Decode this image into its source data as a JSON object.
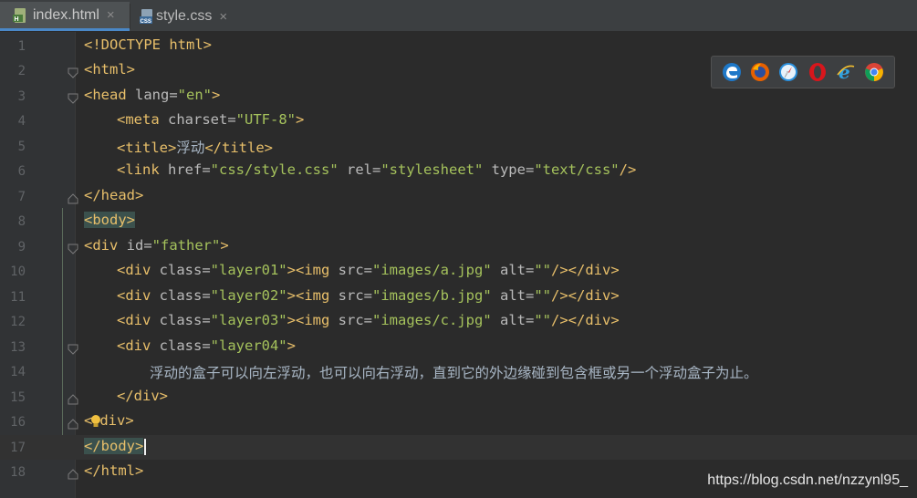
{
  "tabs": [
    {
      "label": "index.html",
      "icon": "html-file-icon",
      "active": true
    },
    {
      "label": "style.css",
      "icon": "css-file-icon",
      "active": false
    }
  ],
  "tab_close_glyph": "×",
  "browsers": [
    "edge-icon",
    "firefox-icon",
    "safari-icon",
    "opera-icon",
    "ie-icon",
    "chrome-icon"
  ],
  "lines": [
    {
      "n": "1"
    },
    {
      "n": "2"
    },
    {
      "n": "3"
    },
    {
      "n": "4"
    },
    {
      "n": "5"
    },
    {
      "n": "6"
    },
    {
      "n": "7"
    },
    {
      "n": "8"
    },
    {
      "n": "9"
    },
    {
      "n": "10"
    },
    {
      "n": "11"
    },
    {
      "n": "12"
    },
    {
      "n": "13"
    },
    {
      "n": "14"
    },
    {
      "n": "15"
    },
    {
      "n": "16"
    },
    {
      "n": "17"
    },
    {
      "n": "18"
    }
  ],
  "code": {
    "l1": "<!DOCTYPE html>",
    "l2": "<html>",
    "l3_tag": "<head",
    "l3_attr": " lang=",
    "l3_val": "\"en\"",
    "l3_end": ">",
    "l4_tag": "<meta",
    "l4_attr": " charset=",
    "l4_val": "\"UTF-8\"",
    "l4_end": ">",
    "l5_open": "<title>",
    "l5_text": "浮动",
    "l5_close": "</title>",
    "l6_tag": "<link",
    "l6_a1": " href=",
    "l6_v1": "\"css/style.css\"",
    "l6_a2": " rel=",
    "l6_v2": "\"stylesheet\"",
    "l6_a3": " type=",
    "l6_v3": "\"text/css\"",
    "l6_end": "/>",
    "l7": "</head>",
    "l8": "<body>",
    "l9_tag": "<div",
    "l9_attr": " id=",
    "l9_val": "\"father\"",
    "l9_end": ">",
    "div_tag": "<div",
    "class_attr": " class=",
    "l10_val": "\"layer01\"",
    "l11_val": "\"layer02\"",
    "l12_val": "\"layer03\"",
    "gt": ">",
    "img_tag": "<img",
    "src_attr": " src=",
    "l10_src": "\"images/a.jpg\"",
    "l11_src": "\"images/b.jpg\"",
    "l12_src": "\"images/c.jpg\"",
    "alt_attr": " alt=",
    "alt_val": "\"\"",
    "img_end": "/>",
    "div_close": "</div>",
    "l13_val": "\"layer04\"",
    "l14_text": "浮动的盒子可以向左浮动，也可以向右浮动，直到它的外边缘碰到包含框或另一个浮动盒子为止。",
    "l15": "</div>",
    "l16_a": "<",
    "l16_b": "div>",
    "l17": "</body>",
    "l18": "</html>"
  },
  "watermark": "https://blog.csdn.net/nzzynl95_",
  "colors": {
    "tag": "#e8bf6a",
    "attr": "#bababa",
    "value": "#a5c25c",
    "text": "#a9b7c6",
    "background": "#2b2b2b",
    "gutter": "#313335"
  }
}
